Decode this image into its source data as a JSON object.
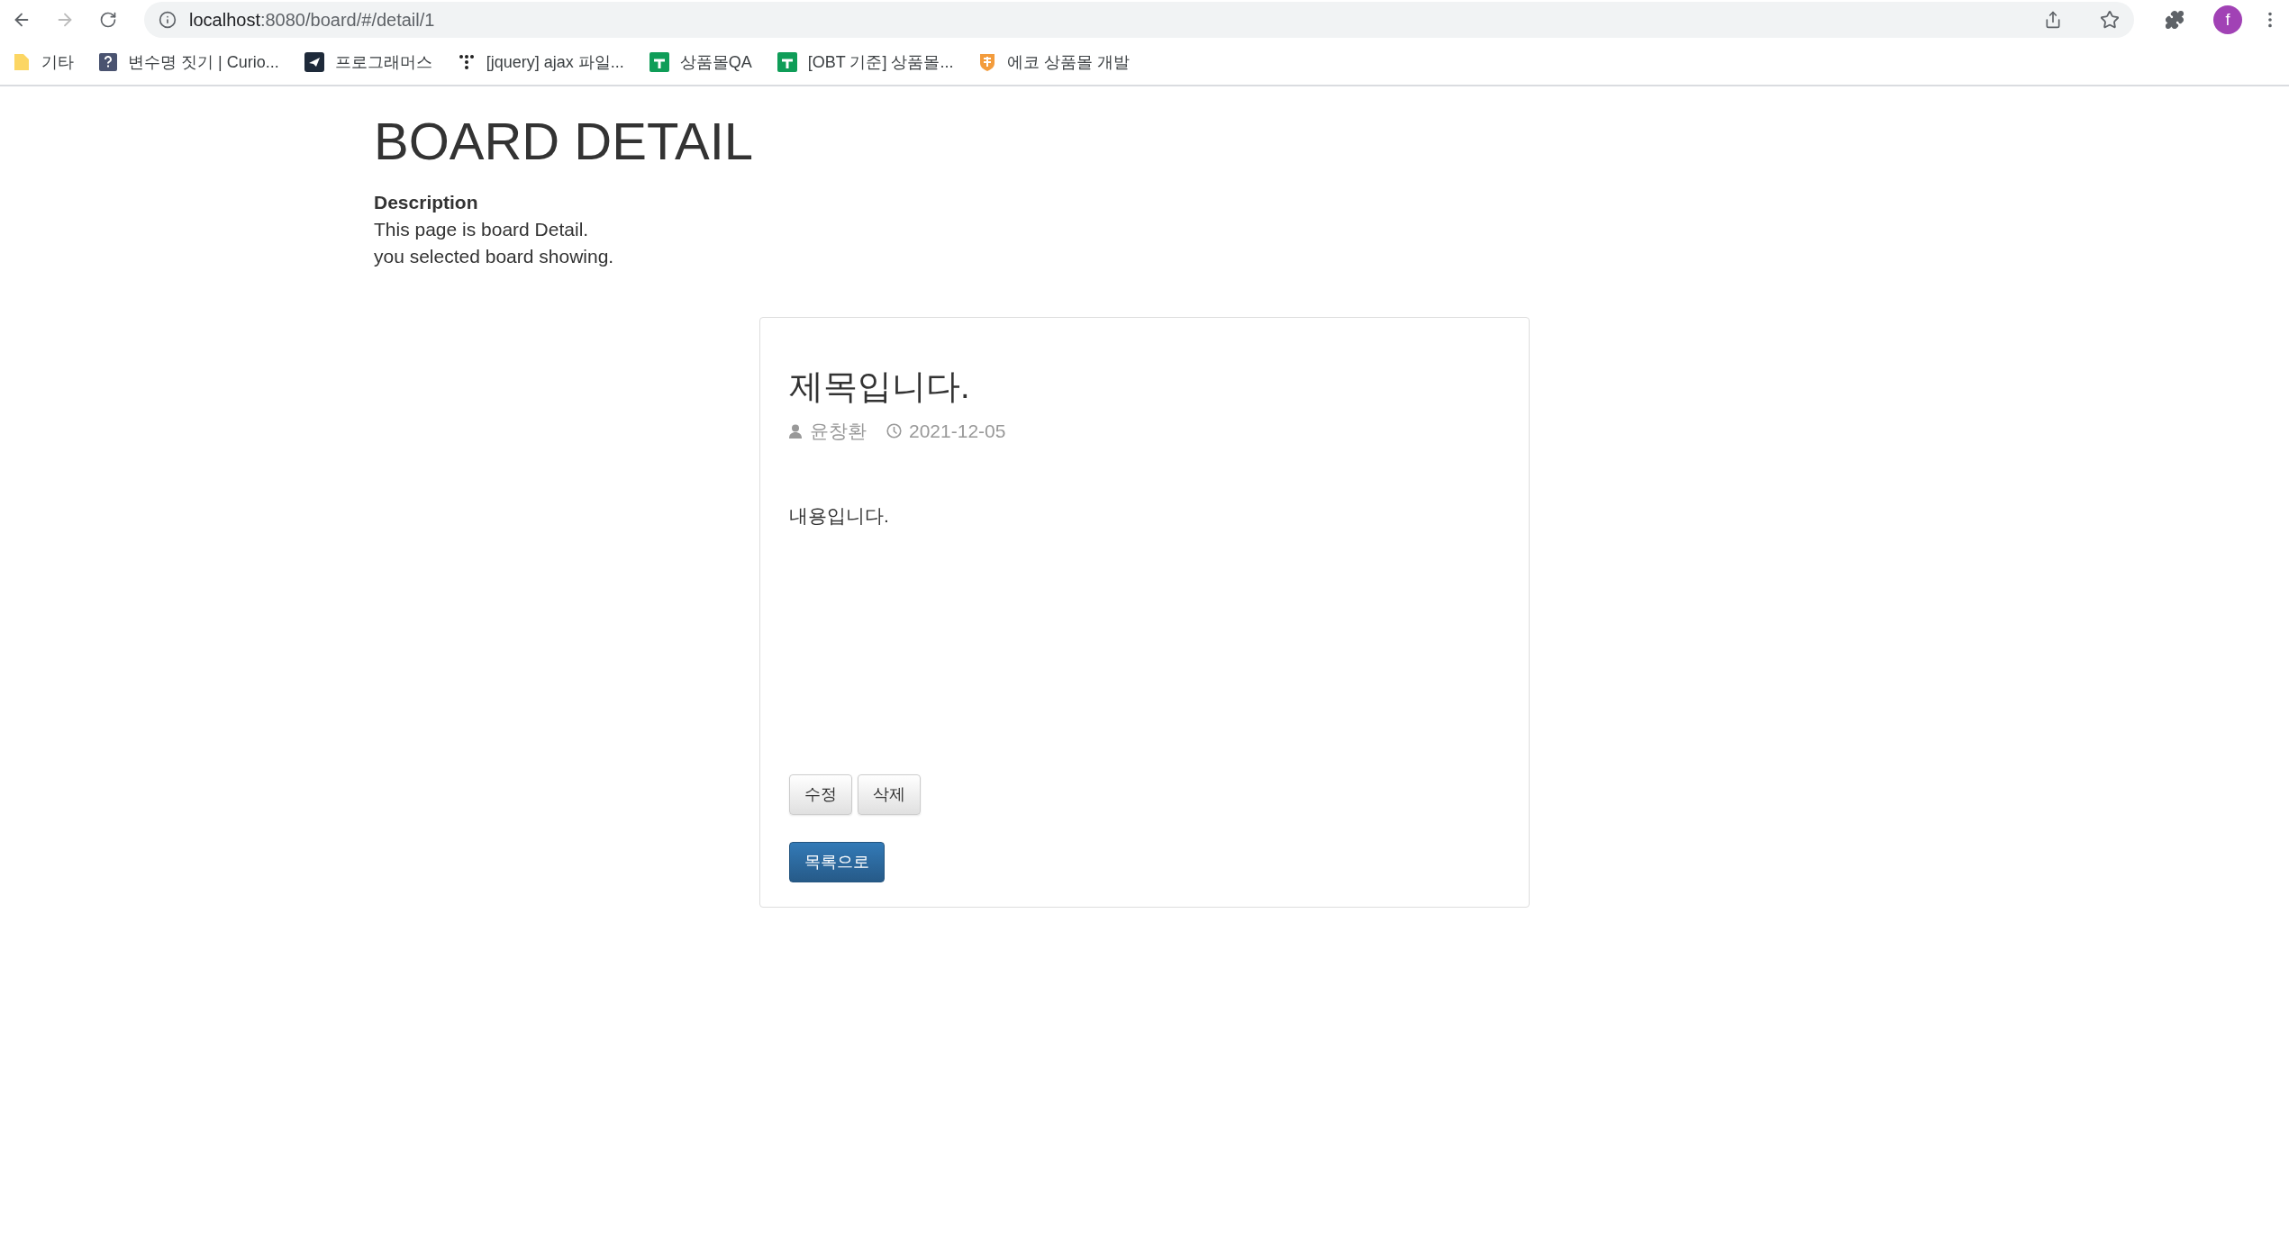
{
  "browser": {
    "back_disabled": false,
    "forward_disabled": true,
    "url_host": "localhost",
    "url_path": ":8080/board/#/detail/1",
    "avatar_letter": "f"
  },
  "bookmarks": [
    {
      "kind": "folder",
      "label": "기타"
    },
    {
      "kind": "question",
      "label": "변수명 짓기 | Curio..."
    },
    {
      "kind": "bird",
      "label": "프로그래머스"
    },
    {
      "kind": "dots",
      "label": "[jquery] ajax 파일..."
    },
    {
      "kind": "sheet",
      "label": "상품몰QA"
    },
    {
      "kind": "sheet",
      "label": "[OBT 기준] 상품몰..."
    },
    {
      "kind": "shield",
      "label": "에코 상품몰 개발"
    }
  ],
  "page": {
    "title": "BOARD DETAIL",
    "description_heading": "Description",
    "description_lines": [
      "This page is board Detail.",
      "you selected board showing."
    ]
  },
  "post": {
    "title": "제목입니다.",
    "author": "윤창환",
    "date": "2021-12-05",
    "content": "내용입니다.",
    "actions": [
      "수정",
      "삭제"
    ],
    "back_button": "목록으로"
  }
}
